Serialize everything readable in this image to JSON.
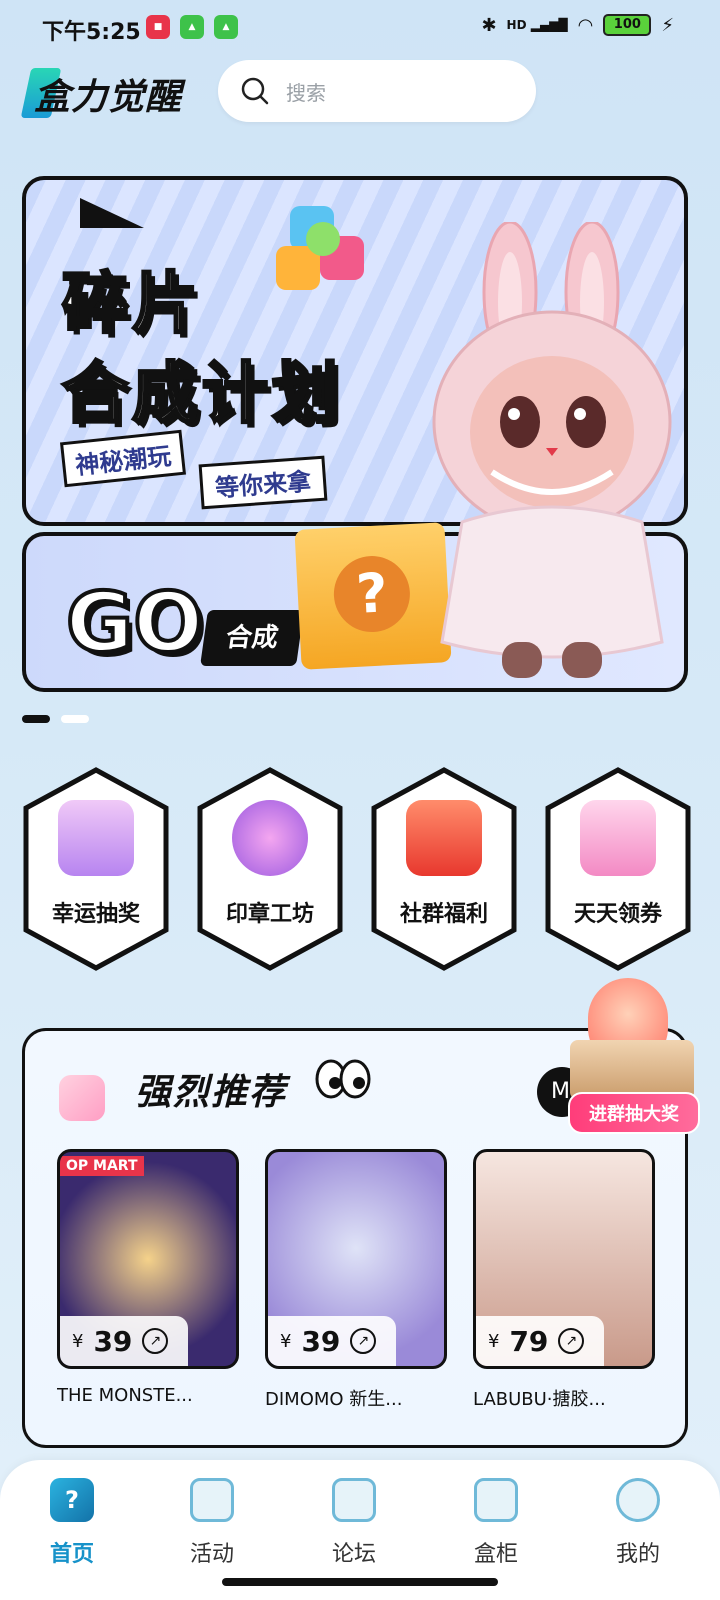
{
  "status_bar": {
    "time": "下午5:25",
    "network": "HD",
    "battery": "100"
  },
  "header": {
    "logo_text": "盒力觉醒",
    "search_placeholder": "搜索"
  },
  "banner": {
    "title_line1": "碎片",
    "title_line2": "合成计划",
    "slogan_1": "神秘潮玩",
    "slogan_2": "等你来拿",
    "go_text": "GO",
    "go_button": "合成",
    "box_mark": "?"
  },
  "quick_entries": [
    {
      "label": "幸运抽奖",
      "icon": "gift-box-icon",
      "color": "#d9a7f0"
    },
    {
      "label": "印章工坊",
      "icon": "diamond-badge-icon",
      "color": "#c27ae8"
    },
    {
      "label": "社群福利",
      "icon": "red-envelope-icon",
      "color": "#f25a3c"
    },
    {
      "label": "天天领券",
      "icon": "shopping-cart-icon",
      "color": "#f5b0d6"
    }
  ],
  "recommend": {
    "title": "强烈推荐",
    "more_label": "M",
    "products": [
      {
        "name": "THE MONSTE...",
        "price": "39",
        "currency": "¥",
        "badge": "OP MART"
      },
      {
        "name": "DIMOMO 新生...",
        "price": "39",
        "currency": "¥"
      },
      {
        "name": "LABUBU·搪胶...",
        "price": "79",
        "currency": "¥"
      }
    ]
  },
  "float_promo": {
    "label": "进群抽大奖"
  },
  "bottom_nav": [
    {
      "label": "首页",
      "icon": "home-cube-icon",
      "active": true
    },
    {
      "label": "活动",
      "icon": "activity-icon",
      "active": false
    },
    {
      "label": "论坛",
      "icon": "forum-icon",
      "active": false
    },
    {
      "label": "盒柜",
      "icon": "box-cabinet-icon",
      "active": false
    },
    {
      "label": "我的",
      "icon": "profile-icon",
      "active": false
    }
  ],
  "colors": {
    "accent": "#1692c9",
    "background": "#d6e9f7",
    "promo_pink": "#ff3d7a"
  }
}
